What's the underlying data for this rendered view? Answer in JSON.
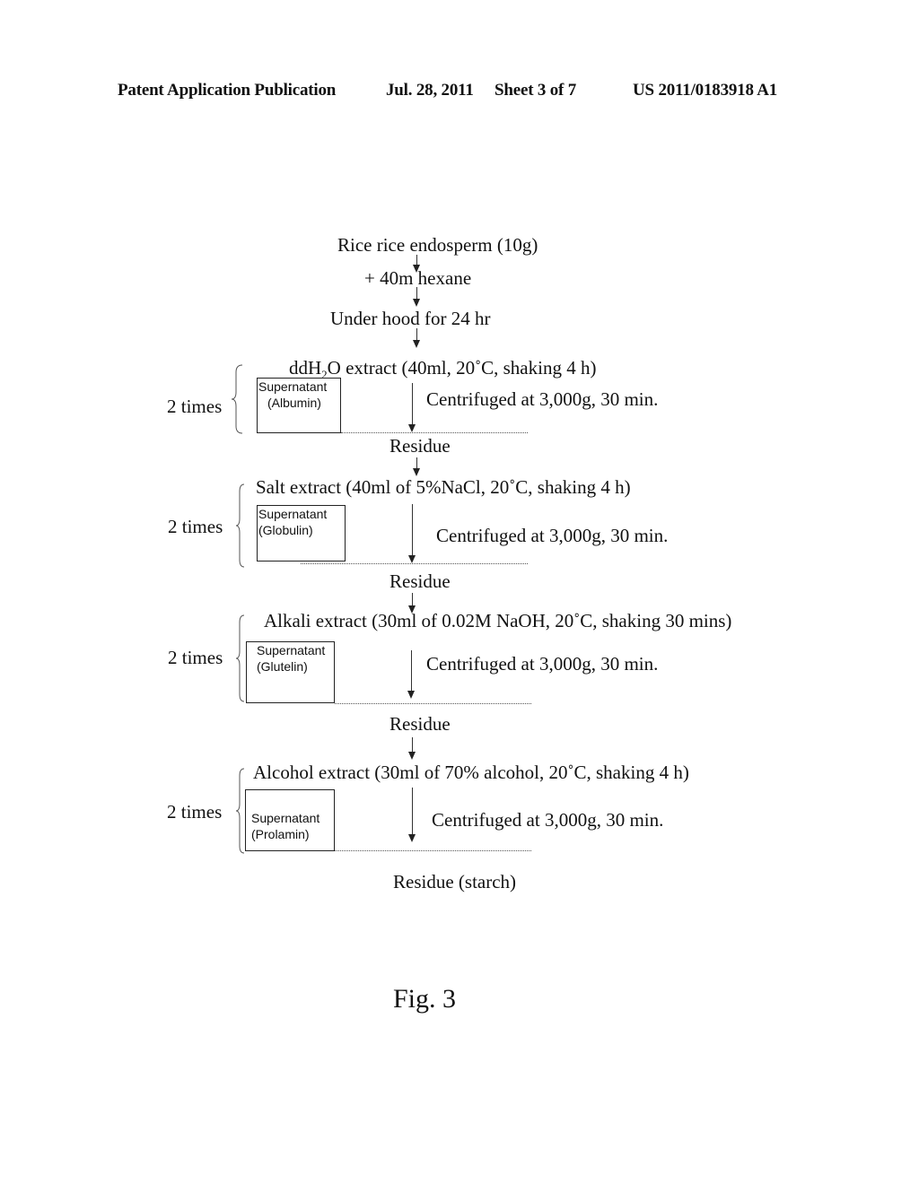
{
  "header": {
    "publication": "Patent Application Publication",
    "date": "Jul. 28, 2011",
    "sheet": "Sheet 3 of 7",
    "number": "US 2011/0183918 A1"
  },
  "flow": {
    "start": "Rice rice endosperm (10g)",
    "hexane": "+ 40m  hexane",
    "hood": "Under hood for 24 hr",
    "stages": [
      {
        "extract_pre": "ddH",
        "extract_sub": "2",
        "extract_post": "O extract (40ml, 20˚C, shaking 4 h)",
        "repeat": "2 times",
        "supernatant_line1": "Supernatant",
        "supernatant_line2": "(Albumin)",
        "centrifuge": "Centrifuged at 3,000g, 30 min.",
        "residue": "Residue"
      },
      {
        "extract": "Salt extract (40ml of 5%NaCl, 20˚C, shaking 4 h)",
        "repeat": "2 times",
        "supernatant_line1": "Supernatant",
        "supernatant_line2": "(Globulin)",
        "centrifuge": "Centrifuged at 3,000g, 30 min.",
        "residue": "Residue"
      },
      {
        "extract": "Alkali extract (30ml of 0.02M NaOH, 20˚C, shaking 30 mins)",
        "repeat": "2 times",
        "supernatant_line1": "Supernatant",
        "supernatant_line2": "(Glutelin)",
        "centrifuge": "Centrifuged at 3,000g, 30 min.",
        "residue": "Residue"
      },
      {
        "extract": "Alcohol extract (30ml of 70% alcohol, 20˚C, shaking 4 h)",
        "repeat": "2 times",
        "supernatant_line1": "Supernatant",
        "supernatant_line2": "(Prolamin)",
        "centrifuge": "Centrifuged at 3,000g, 30 min.",
        "residue": "Residue (starch)"
      }
    ]
  },
  "figure_label": "Fig. 3"
}
